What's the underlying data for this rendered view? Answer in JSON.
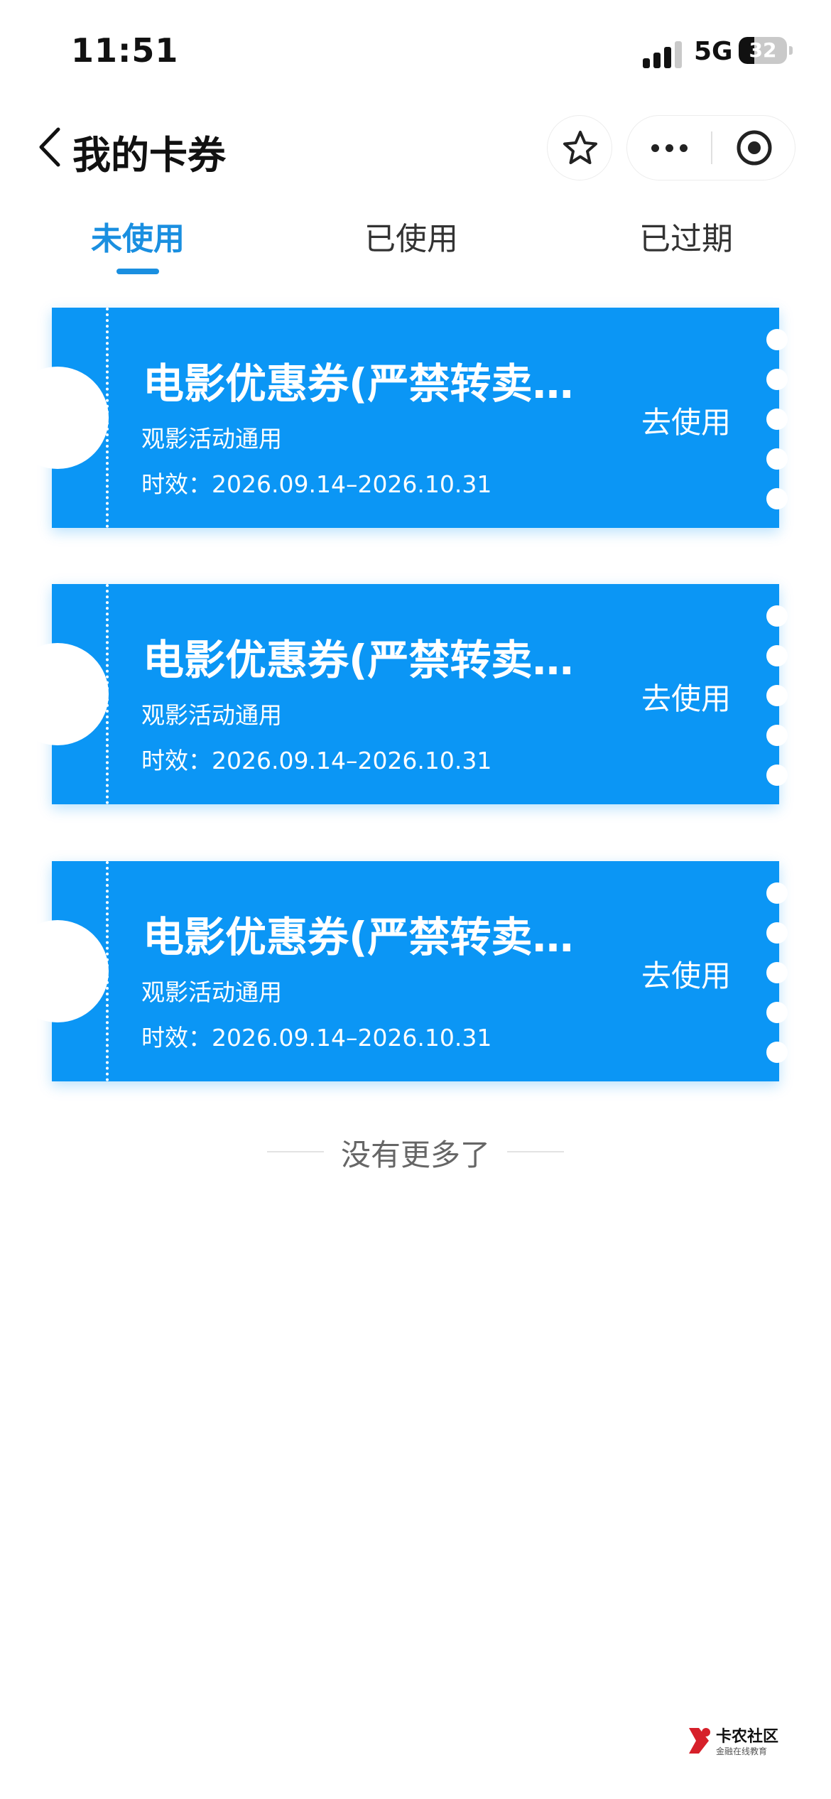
{
  "status_bar": {
    "time": "11:51",
    "network": "5G",
    "battery_level": "32",
    "battery_fraction": 0.32
  },
  "header": {
    "title": "我的卡券",
    "back_icon": "chevron-left-icon",
    "favorite_icon": "star-icon",
    "more_icon": "more-dots-icon",
    "close_icon": "target-circle-icon"
  },
  "tabs": [
    {
      "label": "未使用",
      "active": true
    },
    {
      "label": "已使用",
      "active": false
    },
    {
      "label": "已过期",
      "active": false
    }
  ],
  "coupons": [
    {
      "title": "电影优惠券(严禁转卖…",
      "subtitle": "观影活动通用",
      "validity": "时效：2026.09.14–2026.10.31",
      "action": "去使用"
    },
    {
      "title": "电影优惠券(严禁转卖…",
      "subtitle": "观影活动通用",
      "validity": "时效：2026.09.14–2026.10.31",
      "action": "去使用"
    },
    {
      "title": "电影优惠券(严禁转卖…",
      "subtitle": "观影活动通用",
      "validity": "时效：2026.09.14–2026.10.31",
      "action": "去使用"
    }
  ],
  "list_end_text": "没有更多了",
  "watermark": {
    "name": "卡农社区",
    "tagline": "金融在线教育"
  },
  "colors": {
    "accent": "#1a8fe0",
    "coupon_bg": "#0b96f5",
    "text_primary": "#111111",
    "text_muted": "#666666"
  }
}
